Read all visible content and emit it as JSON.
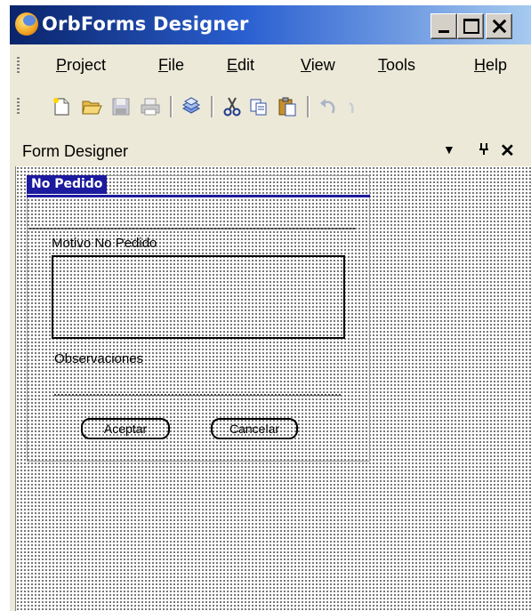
{
  "window": {
    "title": "OrbForms Designer"
  },
  "menu": {
    "items": [
      {
        "label": "Project",
        "ul": "P",
        "rest": "roject"
      },
      {
        "label": "File",
        "ul": "F",
        "rest": "ile"
      },
      {
        "label": "Edit",
        "ul": "E",
        "rest": "dit"
      },
      {
        "label": "View",
        "ul": "V",
        "rest": "iew"
      },
      {
        "label": "Tools",
        "ul": "T",
        "rest": "ools"
      },
      {
        "label": "Help",
        "ul": "H",
        "rest": "elp"
      }
    ]
  },
  "toolbar": {
    "icons": [
      "new-file-icon",
      "open-folder-icon",
      "save-icon",
      "print-icon",
      "build-icon",
      "cut-icon",
      "copy-icon",
      "paste-icon",
      "undo-icon"
    ]
  },
  "panel": {
    "title": "Form Designer",
    "dropdown_glyph": "▼",
    "pin_glyph": "ᆨ",
    "close_glyph": "✕"
  },
  "form": {
    "title": "No Pedido",
    "label_motivo": "Motivo No Pedido",
    "label_observaciones": "Observaciones",
    "btn_aceptar": "Aceptar",
    "btn_cancelar": "Cancelar"
  },
  "colors": {
    "form_title_bg": "#1c1a9e",
    "titlebar_start": "#0a246a",
    "titlebar_end": "#a6caf0"
  }
}
